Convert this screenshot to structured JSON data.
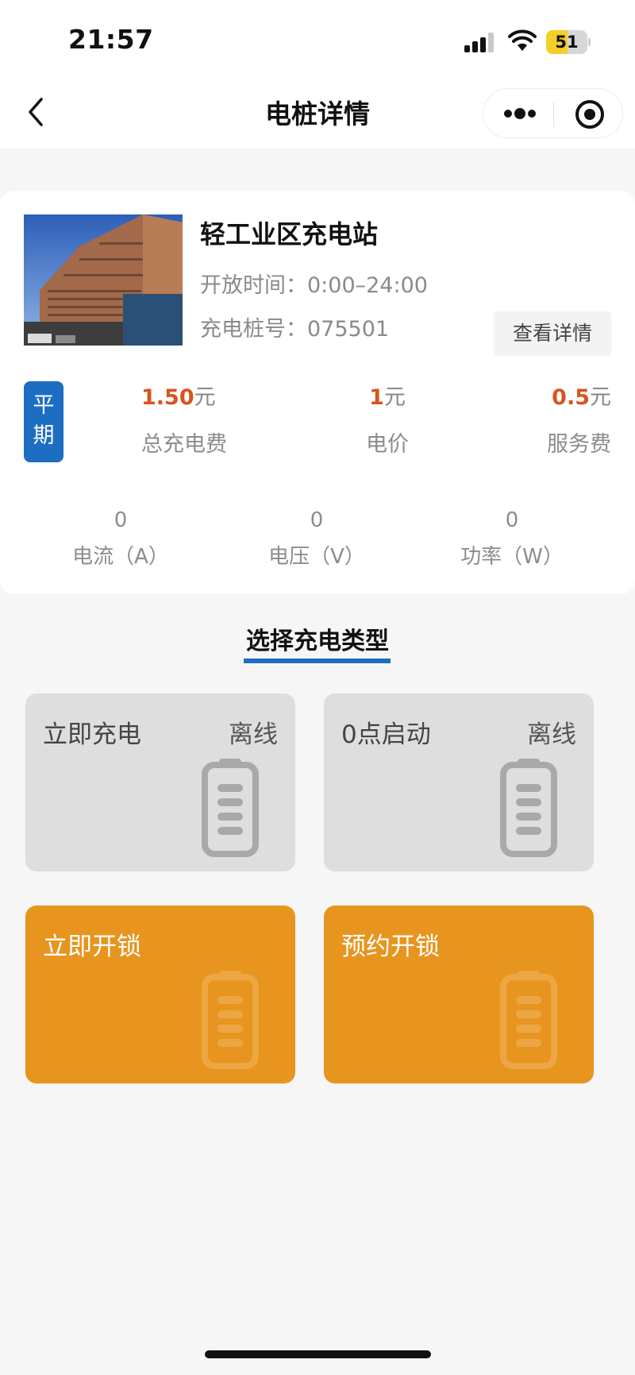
{
  "status_bar": {
    "time": "21:57",
    "battery_level": "51",
    "battery_fraction": 0.51,
    "signal_bars_active": 3,
    "signal_bars_total": 4
  },
  "nav": {
    "title": "电桩详情",
    "back_icon": "chevron-left-icon",
    "more_icon": "more-dots-icon",
    "close_icon": "target-icon"
  },
  "station": {
    "name": "轻工业区充电站",
    "hours_label": "开放时间：",
    "hours_value": "0:00–24:00",
    "pile_label": "充电桩号：",
    "pile_value": "075501",
    "detail_button": "查看详情",
    "period_badge": "平期",
    "fees": [
      {
        "value": "1.50",
        "unit": "元",
        "label": "总充电费"
      },
      {
        "value": "1",
        "unit": "元",
        "label": "电价"
      },
      {
        "value": "0.5",
        "unit": "元",
        "label": "服务费"
      }
    ],
    "meters": [
      {
        "value": "0",
        "label": "电流（A）"
      },
      {
        "value": "0",
        "label": "电压（V）"
      },
      {
        "value": "0",
        "label": "功率（W）"
      }
    ]
  },
  "section": {
    "title": "选择充电类型"
  },
  "options": [
    {
      "label": "立即充电",
      "status": "离线",
      "style": "grey"
    },
    {
      "label": "0点启动",
      "status": "离线",
      "style": "grey"
    },
    {
      "label": "立即开锁",
      "status": "",
      "style": "orange"
    },
    {
      "label": "预约开锁",
      "status": "",
      "style": "orange"
    }
  ],
  "colors": {
    "accent_blue": "#1d6ec2",
    "price_red": "#d9531e",
    "orange_tile": "#e7951f",
    "grey_tile": "#dedede"
  }
}
